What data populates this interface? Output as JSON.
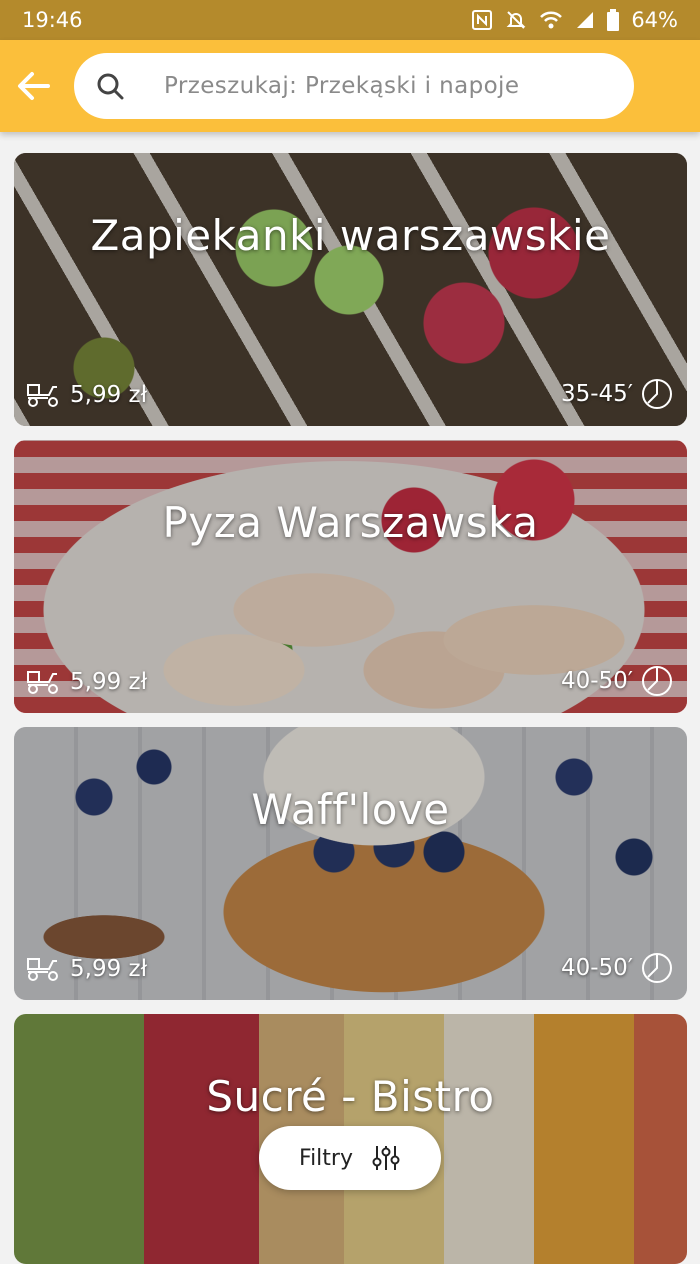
{
  "status_bar": {
    "time": "19:46",
    "battery": "64%"
  },
  "search": {
    "placeholder": "Przeszukaj: Przekąski i napoje"
  },
  "restaurants": [
    {
      "name": "Zapiekanki warszawskie",
      "delivery_fee": "5,99 zł",
      "delivery_time": "35-45′"
    },
    {
      "name": "Pyza Warszawska",
      "delivery_fee": "5,99 zł",
      "delivery_time": "40-50′"
    },
    {
      "name": "Waff'love",
      "delivery_fee": "5,99 zł",
      "delivery_time": "40-50′"
    },
    {
      "name": "Sucré - Bistro"
    }
  ],
  "filters_button": {
    "label": "Filtry"
  },
  "colors": {
    "app_bar": "#fbbf3b",
    "status_bar": "#b48a2c"
  }
}
